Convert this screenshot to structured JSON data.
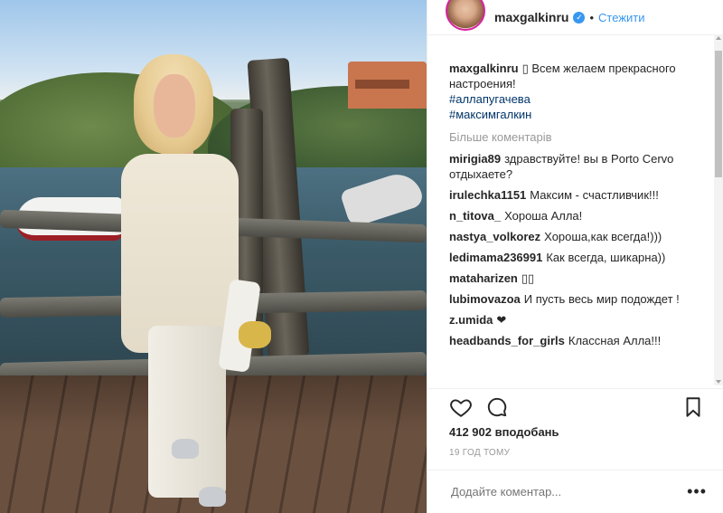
{
  "header": {
    "username": "maxgalkinru",
    "separator": "•",
    "follow_label": "Стежити",
    "verified_badge": "✓"
  },
  "caption": {
    "username": "maxgalkinru",
    "text": "▯ Всем желаем прекрасного настроения!",
    "hashtags": [
      "#аллапугачева",
      "#максимгалкин"
    ]
  },
  "more_comments_label": "Більше коментарів",
  "comments": [
    {
      "user": "mirigia89",
      "text": "здравствуйте! вы в Porto Cervo отдыхаете?"
    },
    {
      "user": "irulechka1151",
      "text": "Максим - счастливчик!!!"
    },
    {
      "user": "n_titova_",
      "text": "Хороша Алла!"
    },
    {
      "user": "nastya_volkorez",
      "text": "Хороша,как всегда!)))"
    },
    {
      "user": "ledimama236991",
      "text": "Как всегда, шикарна))"
    },
    {
      "user": "mataharizen",
      "text": "▯▯"
    },
    {
      "user": "lubimovazoa",
      "text": "И пусть весь мир подождет !"
    },
    {
      "user": "z.umida",
      "text": "❤"
    },
    {
      "user": "headbands_for_girls",
      "text": "Классная Алла!!!"
    }
  ],
  "likes_text": "412 902 вподобань",
  "timestamp": "19 ГОД ТОМУ",
  "add_comment_placeholder": "Додайте коментар...",
  "options_label": "•••",
  "icons": {
    "like": "heart-icon",
    "comment": "comment-icon",
    "save": "bookmark-icon"
  },
  "colors": {
    "link": "#3897f0",
    "hashtag": "#003569",
    "muted": "#999999",
    "text": "#262626"
  }
}
